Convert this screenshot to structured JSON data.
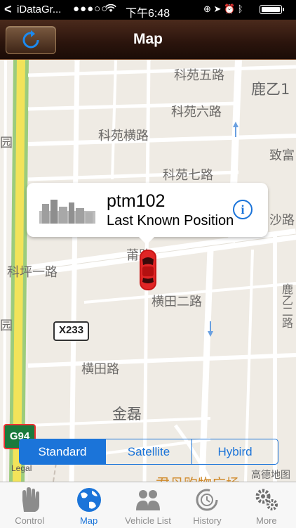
{
  "status_bar": {
    "back_glyph": "<",
    "app_name": "iDataGr...",
    "signal": "●●●○○",
    "time": "下午6:48",
    "icons": "⊕ ➤ ⏰ ᛒ"
  },
  "nav": {
    "title": "Map",
    "refresh_icon": "refresh-icon"
  },
  "map": {
    "labels": [
      {
        "text": "科苑五路"
      },
      {
        "text": "鹿乙1"
      },
      {
        "text": "科苑六路"
      },
      {
        "text": "科苑横路"
      },
      {
        "text": "致富"
      },
      {
        "text": "科苑七路"
      },
      {
        "text": "沙路"
      },
      {
        "text": "莆路"
      },
      {
        "text": "科坪一路"
      },
      {
        "text": "横田二路"
      },
      {
        "text": "鹿乙二路"
      },
      {
        "text": "横田路"
      },
      {
        "text": "金磊"
      },
      {
        "text": "园"
      },
      {
        "text": "园"
      }
    ],
    "road_shield": "X233",
    "highway_shield": "G94",
    "legal": "Legal",
    "provider": "高德地图",
    "bottom_shop": "君丹购物广场"
  },
  "callout": {
    "vehicle_name": "ptm102",
    "subtitle": "Last Known Position"
  },
  "map_type": {
    "options": [
      "Standard",
      "Satellite",
      "Hybird"
    ],
    "selected": "Standard"
  },
  "tabs": [
    {
      "label": "Control",
      "icon": "hand-icon"
    },
    {
      "label": "Map",
      "icon": "globe-icon"
    },
    {
      "label": "Vehicle List",
      "icon": "people-icon"
    },
    {
      "label": "History",
      "icon": "history-icon"
    },
    {
      "label": "More",
      "icon": "gears-icon"
    }
  ],
  "active_tab": "Map",
  "colors": {
    "accent": "#1b74d9",
    "nav_bg": "#2a140c",
    "map_bg": "#f2efe9",
    "car": "#d42020"
  }
}
